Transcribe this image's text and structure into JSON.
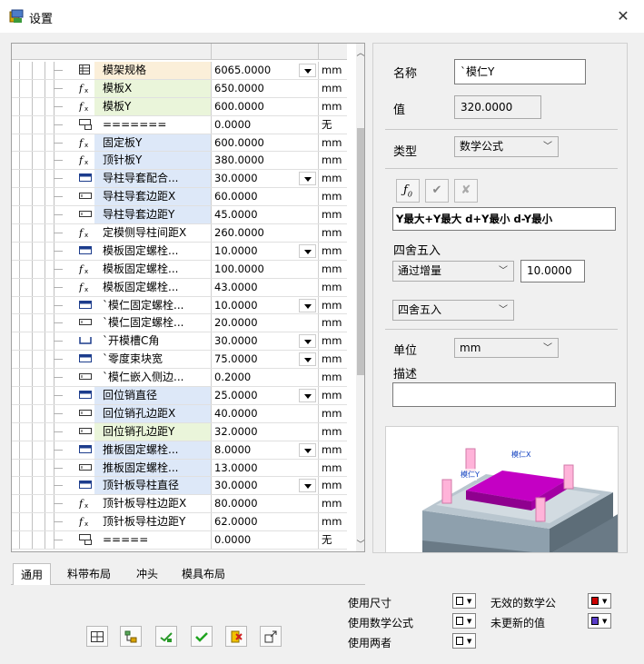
{
  "window": {
    "title": "设置",
    "close_glyph": "✕"
  },
  "grid": {
    "rows": [
      {
        "icon": "table-icon",
        "name": "模架规格",
        "value": "6065.0000",
        "dropdown": true,
        "unit": "mm",
        "bg": "orange"
      },
      {
        "icon": "formula-icon",
        "name": "模板X",
        "value": "650.0000",
        "dropdown": false,
        "unit": "mm",
        "bg": "green"
      },
      {
        "icon": "formula-icon",
        "name": "模板Y",
        "value": "600.0000",
        "dropdown": false,
        "unit": "mm",
        "bg": "green"
      },
      {
        "icon": "separator-icon",
        "name": "=======",
        "value": "0.0000",
        "dropdown": false,
        "unit": "无",
        "bg": ""
      },
      {
        "icon": "formula-icon",
        "name": "固定板Y",
        "value": "600.0000",
        "dropdown": false,
        "unit": "mm",
        "bg": "blue"
      },
      {
        "icon": "formula-icon",
        "name": "顶针板Y",
        "value": "380.0000",
        "dropdown": false,
        "unit": "mm",
        "bg": "blue"
      },
      {
        "icon": "list-icon",
        "name": "导柱导套配合...",
        "value": "30.0000",
        "dropdown": true,
        "unit": "mm",
        "bg": "blue"
      },
      {
        "icon": "input-icon",
        "name": "导柱导套边距X",
        "value": "60.0000",
        "dropdown": false,
        "unit": "mm",
        "bg": "blue"
      },
      {
        "icon": "input-icon",
        "name": "导柱导套边距Y",
        "value": "45.0000",
        "dropdown": false,
        "unit": "mm",
        "bg": "blue"
      },
      {
        "icon": "formula-icon",
        "name": "定模侧导柱间距X",
        "value": "260.0000",
        "dropdown": false,
        "unit": "mm",
        "bg": ""
      },
      {
        "icon": "list-icon",
        "name": "模板固定螺栓...",
        "value": "10.0000",
        "dropdown": true,
        "unit": "mm",
        "bg": ""
      },
      {
        "icon": "formula-icon",
        "name": "模板固定螺栓...",
        "value": "100.0000",
        "dropdown": false,
        "unit": "mm",
        "bg": ""
      },
      {
        "icon": "formula-icon",
        "name": "模板固定螺栓...",
        "value": "43.0000",
        "dropdown": false,
        "unit": "mm",
        "bg": ""
      },
      {
        "icon": "list-icon",
        "name": "`模仁固定螺栓...",
        "value": "10.0000",
        "dropdown": true,
        "unit": "mm",
        "bg": ""
      },
      {
        "icon": "input-icon",
        "name": "`模仁固定螺栓...",
        "value": "20.0000",
        "dropdown": false,
        "unit": "mm",
        "bg": ""
      },
      {
        "icon": "bracket-icon",
        "name": "`开模槽C角",
        "value": "30.0000",
        "dropdown": true,
        "unit": "mm",
        "bg": ""
      },
      {
        "icon": "list-icon",
        "name": "`零度束块宽",
        "value": "75.0000",
        "dropdown": true,
        "unit": "mm",
        "bg": ""
      },
      {
        "icon": "input-icon",
        "name": "`模仁嵌入侧边...",
        "value": "0.2000",
        "dropdown": false,
        "unit": "mm",
        "bg": ""
      },
      {
        "icon": "list-icon",
        "name": "回位销直径",
        "value": "25.0000",
        "dropdown": true,
        "unit": "mm",
        "bg": "blue"
      },
      {
        "icon": "input-icon",
        "name": "回位销孔边距X",
        "value": "40.0000",
        "dropdown": false,
        "unit": "mm",
        "bg": "blue"
      },
      {
        "icon": "input-icon",
        "name": "回位销孔边距Y",
        "value": "32.0000",
        "dropdown": false,
        "unit": "mm",
        "bg": "green"
      },
      {
        "icon": "list-icon",
        "name": "推板固定螺栓...",
        "value": "8.0000",
        "dropdown": true,
        "unit": "mm",
        "bg": "blue"
      },
      {
        "icon": "input-icon",
        "name": "推板固定螺栓...",
        "value": "13.0000",
        "dropdown": false,
        "unit": "mm",
        "bg": "blue"
      },
      {
        "icon": "list-icon",
        "name": "顶针板导柱直径",
        "value": "30.0000",
        "dropdown": true,
        "unit": "mm",
        "bg": "blue"
      },
      {
        "icon": "formula-icon",
        "name": "顶针板导柱边距X",
        "value": "80.0000",
        "dropdown": false,
        "unit": "mm",
        "bg": ""
      },
      {
        "icon": "formula-icon",
        "name": "顶针板导柱边距Y",
        "value": "62.0000",
        "dropdown": false,
        "unit": "mm",
        "bg": ""
      },
      {
        "icon": "separator-icon",
        "name": "=====",
        "value": "0.0000",
        "dropdown": false,
        "unit": "无",
        "bg": ""
      }
    ]
  },
  "tabs": [
    "通用",
    "料带布局",
    "冲头",
    "模具布局"
  ],
  "legend": {
    "use_dimension": "使用尺寸",
    "use_formula": "使用数学公式",
    "use_both": "使用两者",
    "invalid_formula": "无效的数学公",
    "not_updated": "未更新的值",
    "colors": {
      "invalid": "#cc0000",
      "not_updated": "#5a3cc8"
    }
  },
  "toolbar": [
    "grid-icon",
    "tree-icon",
    "link-icon",
    "check-icon",
    "delete-icon",
    "export-icon"
  ],
  "panel": {
    "name_label": "名称",
    "name_value": "`模仁Y",
    "value_label": "值",
    "value_value": "320.0000",
    "type_label": "类型",
    "type_value": "数学公式",
    "formula": "Y最大+Y最大  d+Y最小  d-Y最小",
    "rounding_label": "四舍五入",
    "rounding_mode": "通过增量",
    "rounding_increment": "10.0000",
    "rounding_method": "四舍五入",
    "unit_label": "单位",
    "unit_value": "mm",
    "desc_label": "描述",
    "desc_value": "",
    "preview_tags": [
      "模仁X",
      "模仁Y"
    ]
  }
}
